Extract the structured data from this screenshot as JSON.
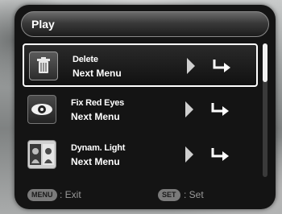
{
  "header": {
    "title": "Play"
  },
  "menu": {
    "items": [
      {
        "title": "Delete",
        "subtitle": "Next Menu",
        "icon": "trash-icon",
        "selected": true
      },
      {
        "title": "Fix Red Eyes",
        "subtitle": "Next Menu",
        "icon": "eye-icon",
        "selected": false
      },
      {
        "title": "Dynam. Light",
        "subtitle": "Next Menu",
        "icon": "dynamic-light-icon",
        "selected": false
      }
    ]
  },
  "scrollbar": {
    "position": 0.0
  },
  "footer": {
    "menu_key": "MENU",
    "menu_action": ": Exit",
    "set_key": "SET",
    "set_action": ": Set"
  },
  "colors": {
    "panel": "#141414",
    "selected_border": "#ffffff",
    "text": "#ffffff",
    "footer_text": "#9a9a9a"
  }
}
